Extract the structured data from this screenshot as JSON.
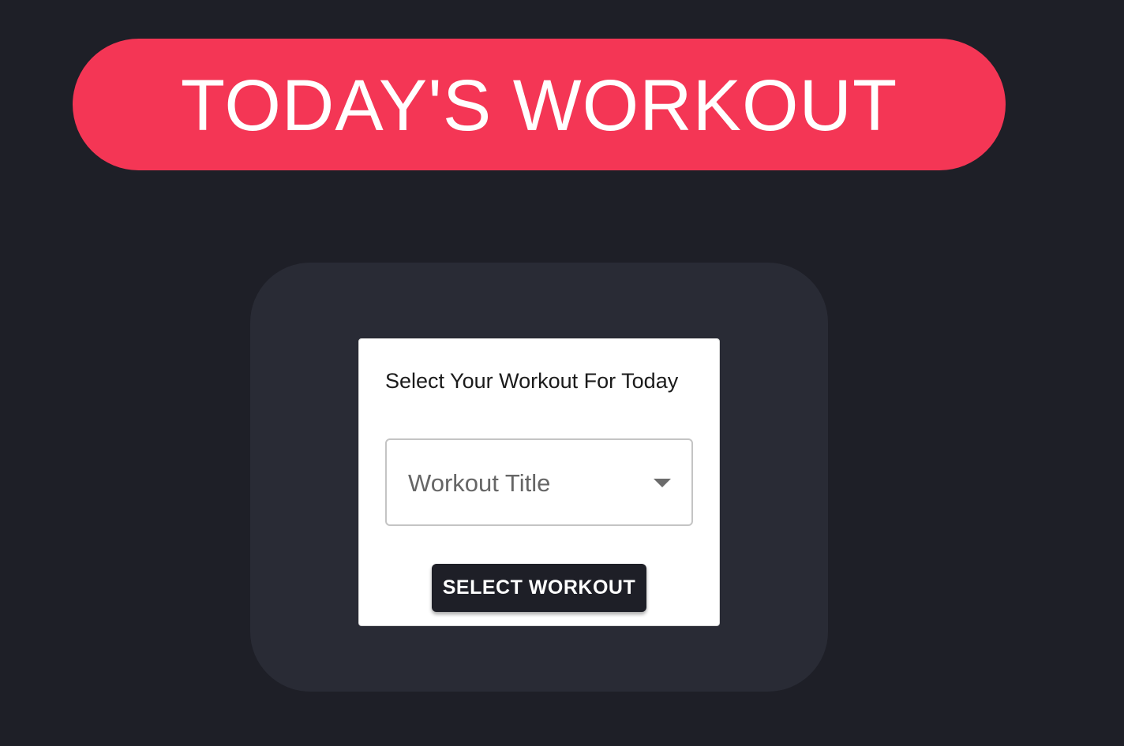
{
  "header": {
    "title": "TODAY'S WORKOUT"
  },
  "workout_card": {
    "label": "Select Your Workout For Today",
    "select": {
      "placeholder": "Workout Title",
      "icon": "triangle-down-icon"
    },
    "button_label": "SELECT WORKOUT"
  },
  "colors": {
    "background": "#1e1f27",
    "banner": "#f43655",
    "panel": "#292b35",
    "card": "#ffffff",
    "button": "#1e1f27"
  }
}
